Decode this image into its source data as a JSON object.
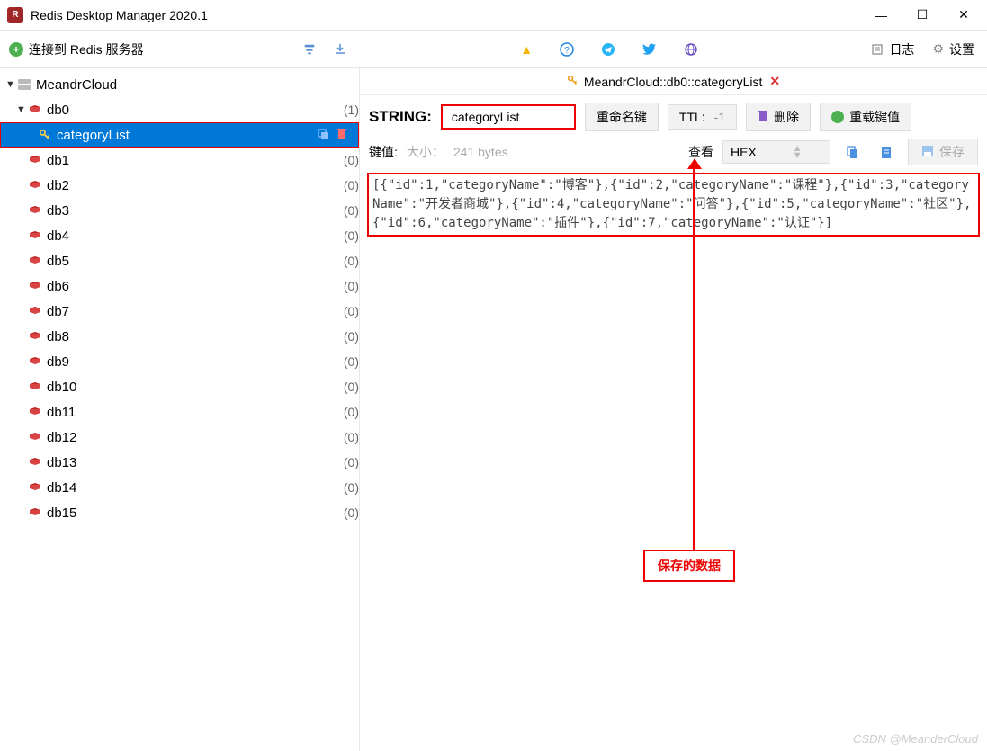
{
  "titlebar": {
    "app_title": "Redis Desktop Manager 2020.1"
  },
  "toolbar": {
    "connect_label": "连接到 Redis 服务器",
    "log_label": "日志",
    "settings_label": "设置"
  },
  "tree": {
    "connection_name": "MeandrCloud",
    "db0": {
      "label": "db0",
      "count": "(1)"
    },
    "selected_key": "categoryList",
    "dbs": [
      {
        "label": "db1",
        "count": "(0)"
      },
      {
        "label": "db2",
        "count": "(0)"
      },
      {
        "label": "db3",
        "count": "(0)"
      },
      {
        "label": "db4",
        "count": "(0)"
      },
      {
        "label": "db5",
        "count": "(0)"
      },
      {
        "label": "db6",
        "count": "(0)"
      },
      {
        "label": "db7",
        "count": "(0)"
      },
      {
        "label": "db8",
        "count": "(0)"
      },
      {
        "label": "db9",
        "count": "(0)"
      },
      {
        "label": "db10",
        "count": "(0)"
      },
      {
        "label": "db11",
        "count": "(0)"
      },
      {
        "label": "db12",
        "count": "(0)"
      },
      {
        "label": "db13",
        "count": "(0)"
      },
      {
        "label": "db14",
        "count": "(0)"
      },
      {
        "label": "db15",
        "count": "(0)"
      }
    ]
  },
  "tab": {
    "title": "MeandrCloud::db0::categoryList"
  },
  "key": {
    "type_label": "STRING:",
    "name": "categoryList",
    "rename_label": "重命名键",
    "ttl_label": "TTL:",
    "ttl_value": "-1",
    "delete_label": "删除",
    "reload_label": "重载键值"
  },
  "value_bar": {
    "label": "键值:",
    "size_label": "大小：",
    "size_value": "241 bytes",
    "view_label": "查看",
    "view_mode": "HEX",
    "save_label": "保存"
  },
  "value_text": "[{\"id\":1,\"categoryName\":\"博客\"},{\"id\":2,\"categoryName\":\"课程\"},{\"id\":3,\"categoryName\":\"开发者商城\"},{\"id\":4,\"categoryName\":\"问答\"},{\"id\":5,\"categoryName\":\"社区\"},{\"id\":6,\"categoryName\":\"插件\"},{\"id\":7,\"categoryName\":\"认证\"}]",
  "annotation": "保存的数据",
  "watermark": "CSDN @MeanderCloud"
}
